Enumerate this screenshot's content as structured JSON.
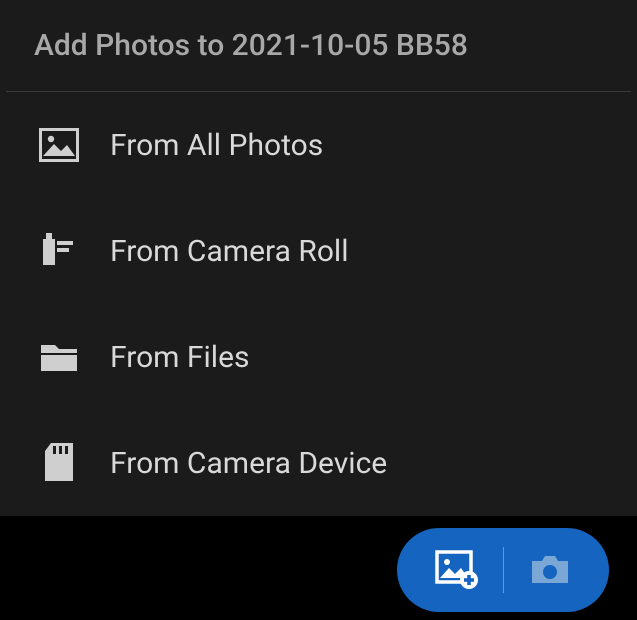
{
  "title": "Add Photos to 2021-10-05 BB58",
  "options": [
    {
      "label": "From All Photos"
    },
    {
      "label": "From Camera Roll"
    },
    {
      "label": "From Files"
    },
    {
      "label": "From Camera Device"
    }
  ]
}
